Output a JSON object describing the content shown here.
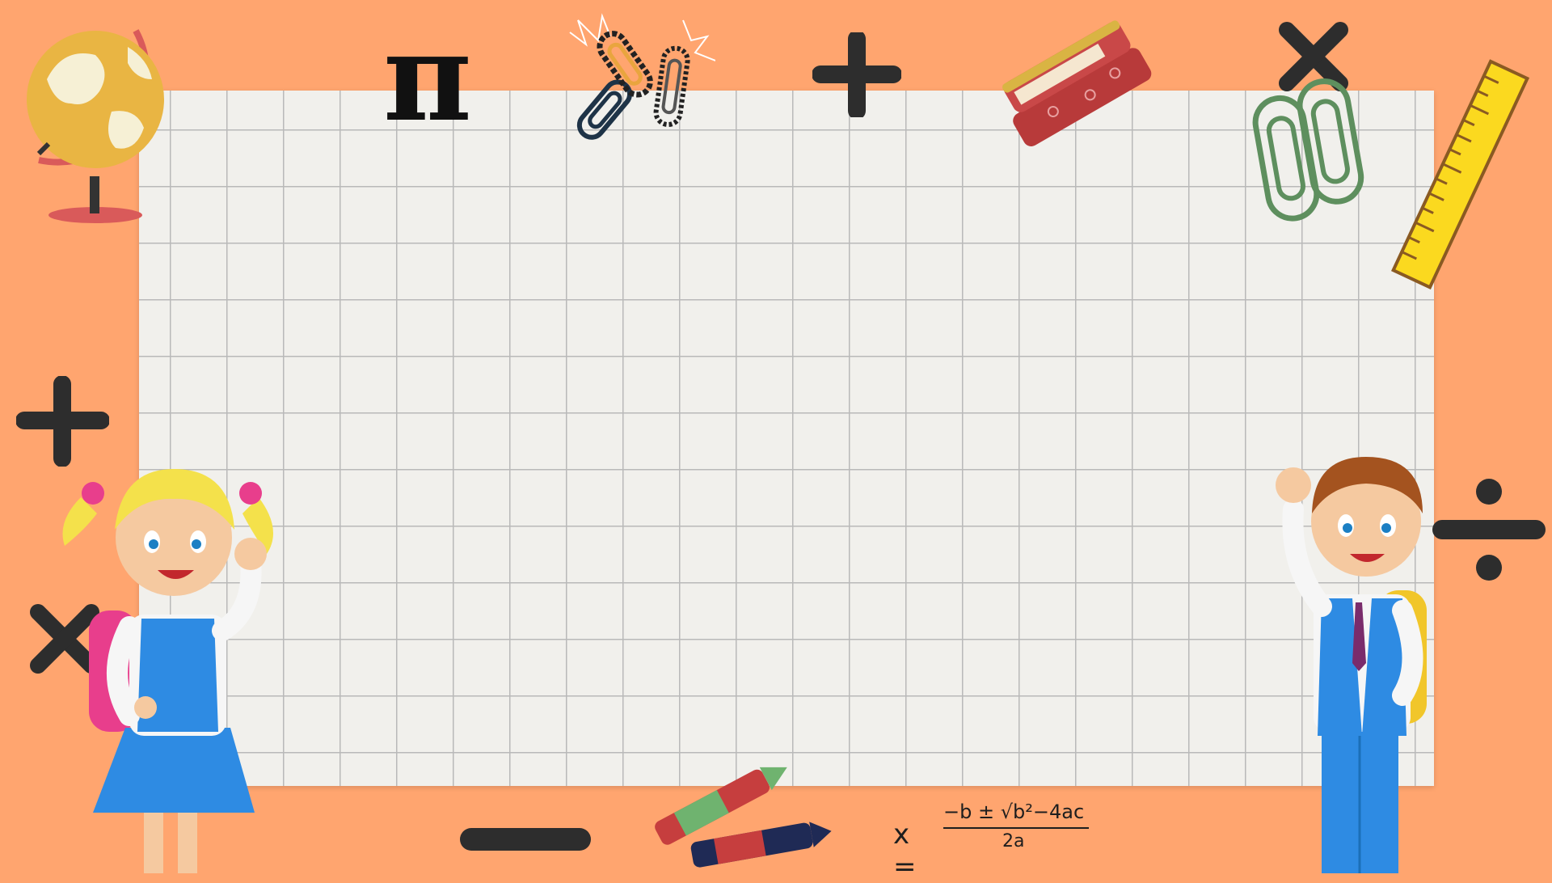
{
  "canvas": {
    "background_color": "#FFA56F",
    "paper_color": "#F1F0EC",
    "grid_color": "#B9B9B9"
  },
  "symbols": {
    "pi": "π",
    "formula": {
      "lhs": "x =",
      "numerator": "−b ± √b²−4ac",
      "denominator": "2a"
    }
  },
  "decorations": {
    "icons": [
      "globe-icon",
      "pi-symbol",
      "paperclips-icon",
      "plus-symbol",
      "stapler-icon",
      "multiply-symbol",
      "ruler-icon",
      "divide-symbol",
      "minus-symbol",
      "crayons-icon",
      "quadratic-formula"
    ],
    "characters": [
      "girl-student",
      "boy-student"
    ]
  }
}
